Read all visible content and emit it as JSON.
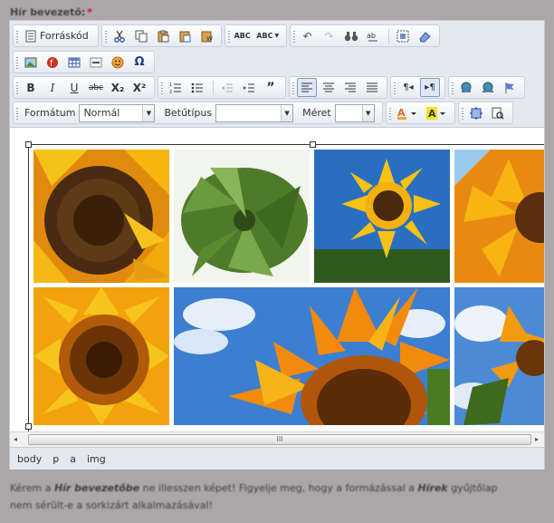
{
  "field": {
    "label": "Hír bevezető:",
    "required_mark": "*"
  },
  "toolbar": {
    "source_label": "Forráskód",
    "format_label": "Formátum",
    "format_value": "Normál",
    "font_label": "Betűtípus",
    "font_value": "",
    "size_label": "Méret",
    "size_value": "",
    "spell_label": "ABC",
    "spell_auto_label": "ABC",
    "subscript": "X₂",
    "superscript": "X²"
  },
  "path": [
    "body",
    "p",
    "a",
    "img"
  ],
  "scrollbar": {
    "thumb_grip": "III"
  },
  "hint": {
    "part1": "Kérem a ",
    "bold1": "Hír bevezetőbe",
    "part2": " ne illesszen képet! Figyelje meg, hogy a formázással a ",
    "bold2": "Hírek",
    "part3": " gyűjtőlap nem sérült-e a sorkizárt alkalmazásával!"
  },
  "colors": {
    "accent": "#7a98cc",
    "required": "#c01515",
    "toolbar_bg": "#e4e8ef"
  }
}
